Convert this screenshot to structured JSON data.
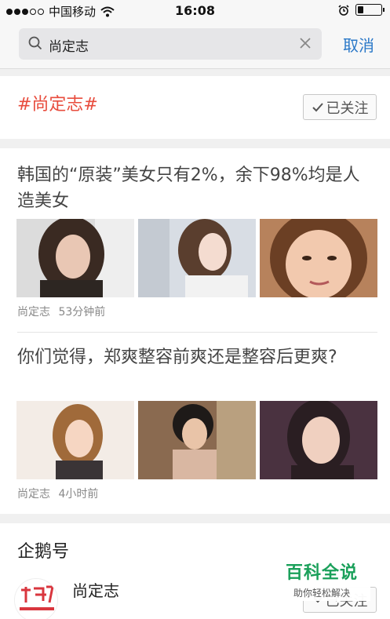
{
  "status_bar": {
    "carrier": "中国移动",
    "time": "16:08",
    "battery_level": 0.25
  },
  "search": {
    "query": "尚定志",
    "cancel_label": "取消"
  },
  "topic": {
    "tag_text": "#尚定志#",
    "follow_label": "已关注"
  },
  "articles": [
    {
      "title": "韩国的“原装”美女只有2%，余下98%均是人造美女",
      "author": "尚定志",
      "time": "53分钟前"
    },
    {
      "title": "你们觉得，郑爽整容前爽还是整容后更爽?",
      "author": "尚定志",
      "time": "4小时前"
    }
  ],
  "penguin_section": {
    "title": "企鹅号",
    "account_name": "尚定志",
    "follow_label": "已关注"
  },
  "watermark": {
    "main": "百科全说",
    "sub": "助你轻松解决"
  },
  "colors": {
    "accent_blue": "#2a78c8",
    "tag_red": "#e84c3d",
    "watermark_green": "#1aa05a"
  }
}
